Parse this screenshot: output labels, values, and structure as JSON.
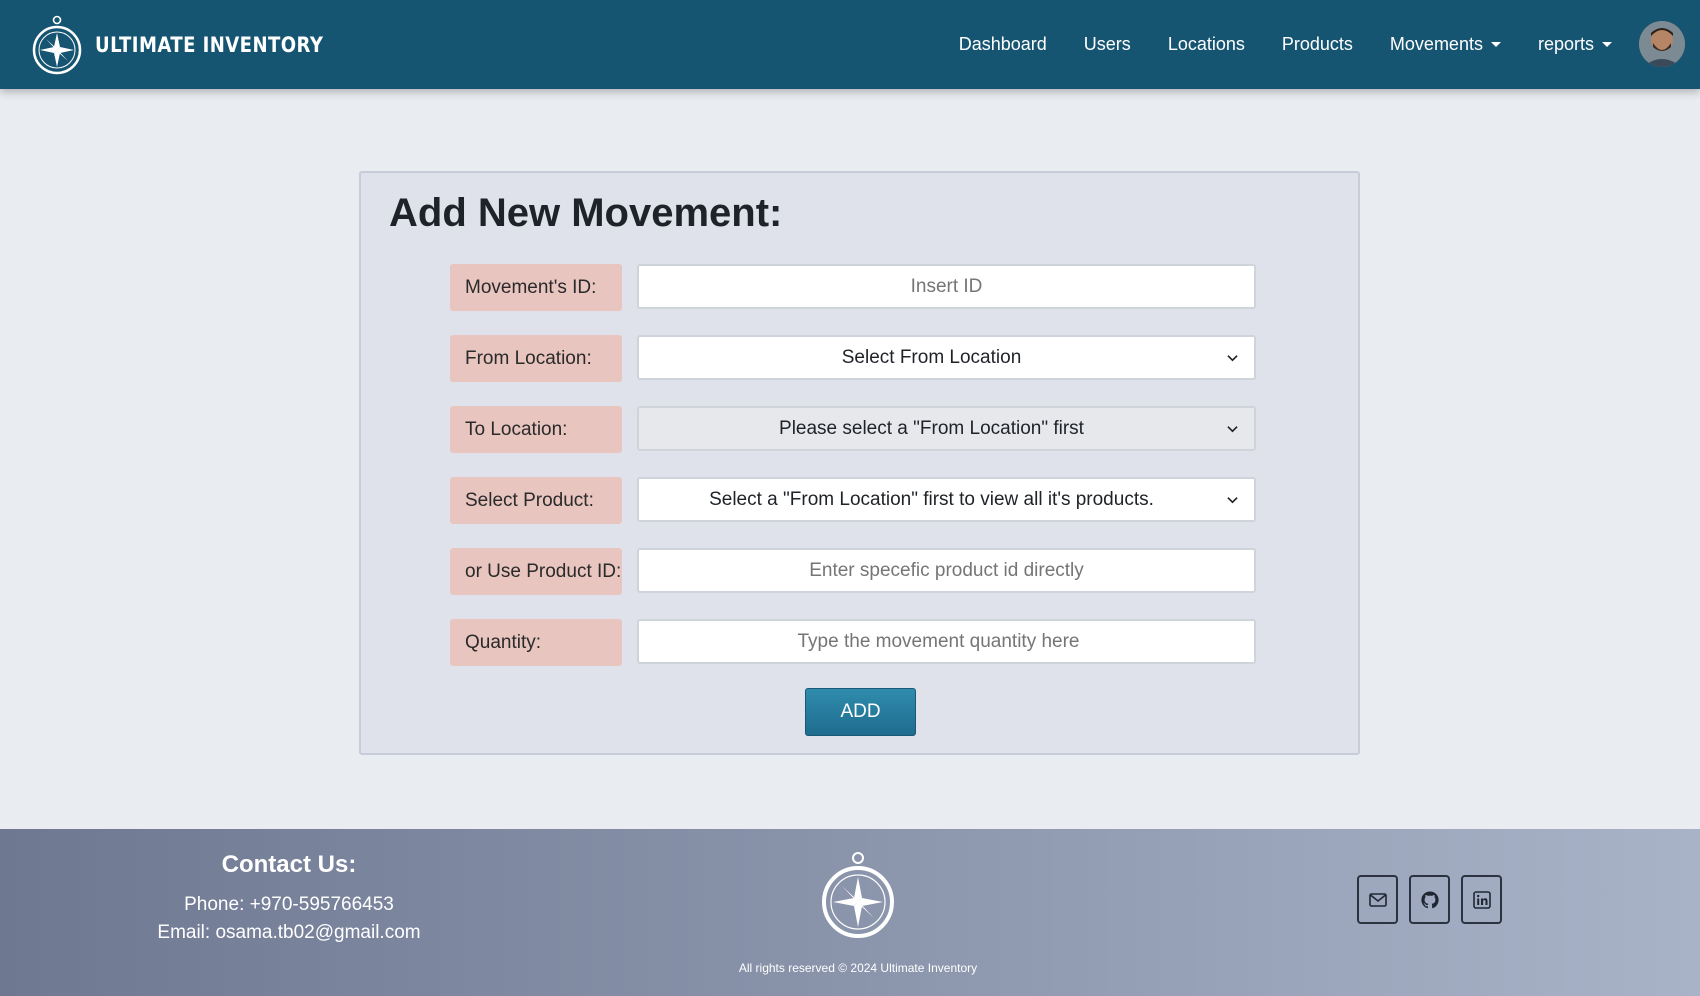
{
  "app": {
    "brand_name": "ULTIMATE INVENTORY"
  },
  "nav": {
    "items": [
      {
        "label": "Dashboard"
      },
      {
        "label": "Users"
      },
      {
        "label": "Locations"
      },
      {
        "label": "Products"
      },
      {
        "label": "Movements",
        "dropdown": true
      },
      {
        "label": "reports",
        "dropdown": true
      }
    ]
  },
  "form": {
    "title": "Add New Movement:",
    "movement_id": {
      "label": "Movement's ID:",
      "placeholder": "Insert ID",
      "value": ""
    },
    "from_location": {
      "label": "From Location:",
      "selected": "Select From Location"
    },
    "to_location": {
      "label": "To Location:",
      "selected": "Please select a \"From Location\" first"
    },
    "product": {
      "label": "Select Product:",
      "selected": "Select a \"From Location\" first to view all it's products."
    },
    "product_id": {
      "label": "or Use Product ID:",
      "placeholder": "Enter specefic product id directly",
      "value": ""
    },
    "quantity": {
      "label": "Quantity:",
      "placeholder": "Type the movement quantity here",
      "value": ""
    },
    "submit_label": "ADD"
  },
  "footer": {
    "contact_title": "Contact Us:",
    "phone": "Phone: +970-595766453",
    "email": "Email: osama.tb02@gmail.com",
    "copyright": "All rights reserved © 2024 Ultimate Inventory",
    "social_icons": [
      "mail-icon",
      "github-icon",
      "linkedin-icon"
    ]
  },
  "colors": {
    "navbar": "#165572",
    "label_bg": "#e8c5bf",
    "button": "#2f8cad",
    "page_bg": "#e9ecf0"
  }
}
